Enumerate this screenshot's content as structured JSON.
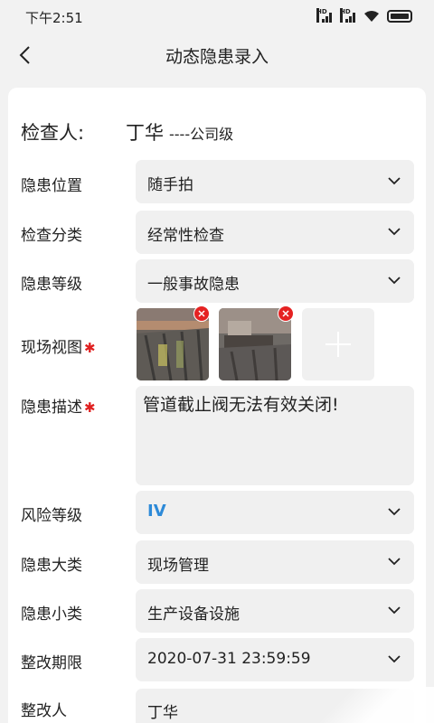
{
  "status_bar": {
    "time": "下午2:51"
  },
  "header": {
    "title": "动态隐患录入"
  },
  "inspector": {
    "label": "检查人:",
    "name": "丁华",
    "level": "----公司级"
  },
  "fields": [
    {
      "label": "隐患位置",
      "value": "随手拍"
    },
    {
      "label": "检查分类",
      "value": "经常性检查"
    },
    {
      "label": "隐患等级",
      "value": "一般事故隐患"
    }
  ],
  "photos": {
    "label": "现场视图",
    "required_mark": "✱"
  },
  "description": {
    "label": "隐患描述",
    "required_mark": "✱",
    "value": "管道截止阀无法有效关闭!"
  },
  "fields2": [
    {
      "label": "风险等级",
      "value": "IV"
    },
    {
      "label": "隐患大类",
      "value": "现场管理"
    },
    {
      "label": "隐患小类",
      "value": "生产设备设施"
    },
    {
      "label": "整改期限",
      "value": "2020-07-31 23:59:59"
    }
  ],
  "rectifier": {
    "label": "整改人",
    "value": "丁华"
  },
  "colors": {
    "accent_blue": "#2d8ad8",
    "required_red": "#e02020",
    "field_bg": "#f0f0f0",
    "close_red": "#e52222"
  }
}
